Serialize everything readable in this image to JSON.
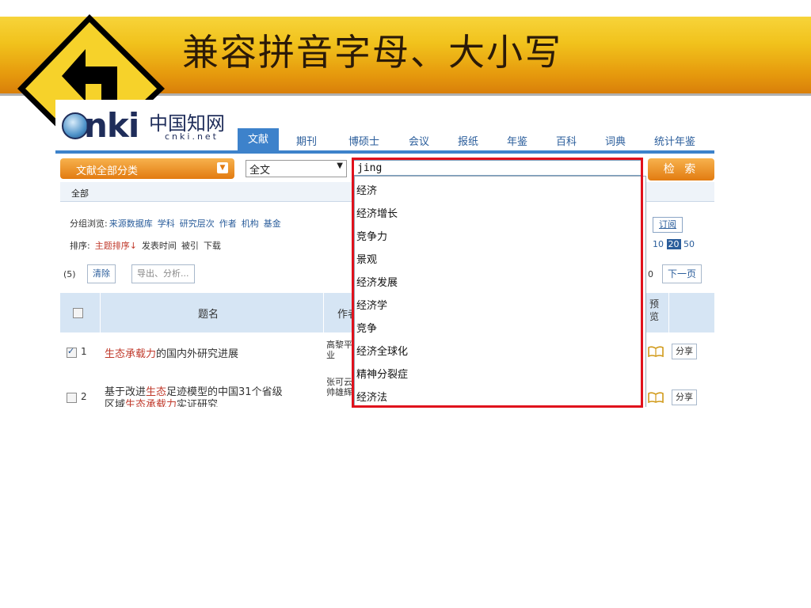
{
  "slide": {
    "title": "兼容拼音字母、大小写",
    "sign_icon": "turn-left-arrow-sign-icon",
    "banner_color": "#f1c21c",
    "highlight_color": "#e0111c"
  },
  "cnki": {
    "logo_text": "nki",
    "logo_cn": "中国知网",
    "logo_sub": "cnki.net",
    "tabs": [
      "期刊",
      "博硕士",
      "会议",
      "报纸",
      "年鉴",
      "百科",
      "词典",
      "统计年鉴"
    ],
    "active_tab": "文献",
    "category_button": "文献全部分类",
    "field_select": "全文",
    "search_value": "jing",
    "search_button": "检 索",
    "breadcrumb": "全部",
    "group_label": "分组浏览:",
    "group_items": [
      "来源数据库",
      "学科",
      "研究层次",
      "作者",
      "机构",
      "基金"
    ],
    "sort_label": "排序:",
    "sort_items": [
      "主题排序↓",
      "发表时间",
      "被引",
      "下载"
    ],
    "result_count": "(5)",
    "clear_button": "清除",
    "export_button": "导出、分析...",
    "subscribe": "订阅",
    "page_sizes": [
      "10",
      "20",
      "50"
    ],
    "page_size_selected": "20",
    "zero_text": "0",
    "next_page": "下一页",
    "table": {
      "headers": {
        "title": "题名",
        "author": "作者",
        "preview": "预览"
      },
      "rows": [
        {
          "num": "1",
          "checked": true,
          "title_parts": [
            "生态承载力",
            "的国内外研究进展"
          ],
          "author": "高黎平\n业",
          "share": "分享"
        },
        {
          "num": "2",
          "checked": false,
          "title_parts": [
            "基于改进",
            "生态",
            "足迹模型的中国31个省级"
          ],
          "title_line2_parts": [
            "区域",
            "生态承载力",
            "实证研究"
          ],
          "author": "张可云\n帅雄辉",
          "share": "分享"
        }
      ]
    },
    "suggestions": [
      "经济",
      "经济增长",
      "竞争力",
      "景观",
      "经济发展",
      "经济学",
      "竞争",
      "经济全球化",
      "精神分裂症",
      "经济法"
    ]
  }
}
